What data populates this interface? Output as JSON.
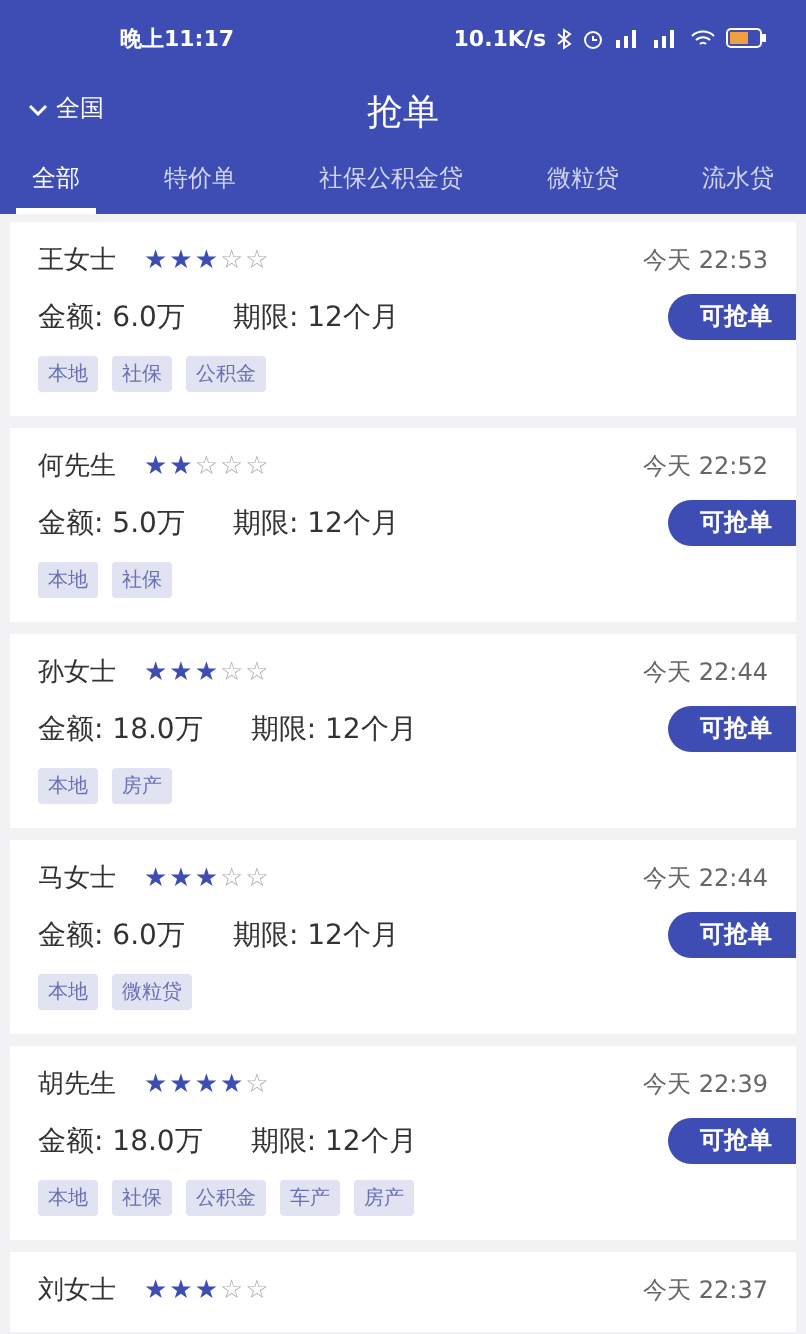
{
  "status_bar": {
    "time": "晚上11:17",
    "speed": "10.1K/s"
  },
  "header": {
    "region": "全国",
    "title": "抢单"
  },
  "tabs": [
    {
      "label": "全部",
      "selected": true
    },
    {
      "label": "特价单",
      "selected": false
    },
    {
      "label": "社保公积金贷",
      "selected": false
    },
    {
      "label": "微粒贷",
      "selected": false
    },
    {
      "label": "流水贷",
      "selected": false
    }
  ],
  "orders": [
    {
      "name": "王女士",
      "stars": 3,
      "time": "今天 22:53",
      "amount_label": "金额:",
      "amount": "6.0万",
      "term_label": "期限:",
      "term": "12个月",
      "button": "可抢单",
      "tags": [
        "本地",
        "社保",
        "公积金"
      ]
    },
    {
      "name": "何先生",
      "stars": 2,
      "time": "今天 22:52",
      "amount_label": "金额:",
      "amount": "5.0万",
      "term_label": "期限:",
      "term": "12个月",
      "button": "可抢单",
      "tags": [
        "本地",
        "社保"
      ]
    },
    {
      "name": "孙女士",
      "stars": 3,
      "time": "今天 22:44",
      "amount_label": "金额:",
      "amount": "18.0万",
      "term_label": "期限:",
      "term": "12个月",
      "button": "可抢单",
      "tags": [
        "本地",
        "房产"
      ]
    },
    {
      "name": "马女士",
      "stars": 3,
      "time": "今天 22:44",
      "amount_label": "金额:",
      "amount": "6.0万",
      "term_label": "期限:",
      "term": "12个月",
      "button": "可抢单",
      "tags": [
        "本地",
        "微粒贷"
      ]
    },
    {
      "name": "胡先生",
      "stars": 4,
      "time": "今天 22:39",
      "amount_label": "金额:",
      "amount": "18.0万",
      "term_label": "期限:",
      "term": "12个月",
      "button": "可抢单",
      "tags": [
        "本地",
        "社保",
        "公积金",
        "车产",
        "房产"
      ]
    },
    {
      "name": "刘女士",
      "stars": 3,
      "time": "今天 22:37"
    }
  ]
}
